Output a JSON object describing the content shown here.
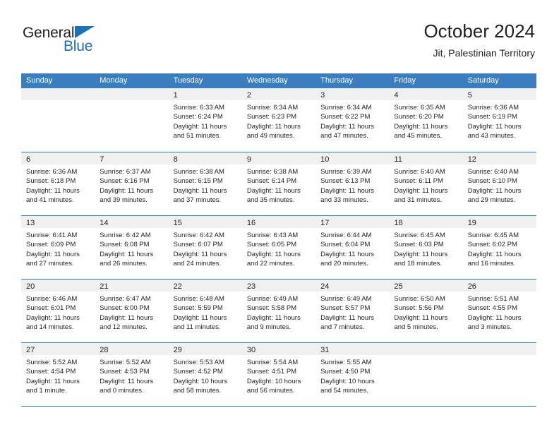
{
  "brand": {
    "name_part1": "General",
    "name_part2": "Blue",
    "triangle_color": "#1b72b8",
    "blue_color": "#1f6fb5"
  },
  "header": {
    "month_title": "October 2024",
    "location": "Jit, Palestinian Territory"
  },
  "theme": {
    "header_blue": "#3a7ebf",
    "daynum_band": "#f0f0f0",
    "text": "#231f20"
  },
  "calendar": {
    "weekday_headers": [
      "Sunday",
      "Monday",
      "Tuesday",
      "Wednesday",
      "Thursday",
      "Friday",
      "Saturday"
    ],
    "weeks": [
      [
        {
          "day": "",
          "lines": []
        },
        {
          "day": "",
          "lines": []
        },
        {
          "day": "1",
          "lines": [
            "Sunrise: 6:33 AM",
            "Sunset: 6:24 PM",
            "Daylight: 11 hours",
            "and 51 minutes."
          ]
        },
        {
          "day": "2",
          "lines": [
            "Sunrise: 6:34 AM",
            "Sunset: 6:23 PM",
            "Daylight: 11 hours",
            "and 49 minutes."
          ]
        },
        {
          "day": "3",
          "lines": [
            "Sunrise: 6:34 AM",
            "Sunset: 6:22 PM",
            "Daylight: 11 hours",
            "and 47 minutes."
          ]
        },
        {
          "day": "4",
          "lines": [
            "Sunrise: 6:35 AM",
            "Sunset: 6:20 PM",
            "Daylight: 11 hours",
            "and 45 minutes."
          ]
        },
        {
          "day": "5",
          "lines": [
            "Sunrise: 6:36 AM",
            "Sunset: 6:19 PM",
            "Daylight: 11 hours",
            "and 43 minutes."
          ]
        }
      ],
      [
        {
          "day": "6",
          "lines": [
            "Sunrise: 6:36 AM",
            "Sunset: 6:18 PM",
            "Daylight: 11 hours",
            "and 41 minutes."
          ]
        },
        {
          "day": "7",
          "lines": [
            "Sunrise: 6:37 AM",
            "Sunset: 6:16 PM",
            "Daylight: 11 hours",
            "and 39 minutes."
          ]
        },
        {
          "day": "8",
          "lines": [
            "Sunrise: 6:38 AM",
            "Sunset: 6:15 PM",
            "Daylight: 11 hours",
            "and 37 minutes."
          ]
        },
        {
          "day": "9",
          "lines": [
            "Sunrise: 6:38 AM",
            "Sunset: 6:14 PM",
            "Daylight: 11 hours",
            "and 35 minutes."
          ]
        },
        {
          "day": "10",
          "lines": [
            "Sunrise: 6:39 AM",
            "Sunset: 6:13 PM",
            "Daylight: 11 hours",
            "and 33 minutes."
          ]
        },
        {
          "day": "11",
          "lines": [
            "Sunrise: 6:40 AM",
            "Sunset: 6:11 PM",
            "Daylight: 11 hours",
            "and 31 minutes."
          ]
        },
        {
          "day": "12",
          "lines": [
            "Sunrise: 6:40 AM",
            "Sunset: 6:10 PM",
            "Daylight: 11 hours",
            "and 29 minutes."
          ]
        }
      ],
      [
        {
          "day": "13",
          "lines": [
            "Sunrise: 6:41 AM",
            "Sunset: 6:09 PM",
            "Daylight: 11 hours",
            "and 27 minutes."
          ]
        },
        {
          "day": "14",
          "lines": [
            "Sunrise: 6:42 AM",
            "Sunset: 6:08 PM",
            "Daylight: 11 hours",
            "and 26 minutes."
          ]
        },
        {
          "day": "15",
          "lines": [
            "Sunrise: 6:42 AM",
            "Sunset: 6:07 PM",
            "Daylight: 11 hours",
            "and 24 minutes."
          ]
        },
        {
          "day": "16",
          "lines": [
            "Sunrise: 6:43 AM",
            "Sunset: 6:05 PM",
            "Daylight: 11 hours",
            "and 22 minutes."
          ]
        },
        {
          "day": "17",
          "lines": [
            "Sunrise: 6:44 AM",
            "Sunset: 6:04 PM",
            "Daylight: 11 hours",
            "and 20 minutes."
          ]
        },
        {
          "day": "18",
          "lines": [
            "Sunrise: 6:45 AM",
            "Sunset: 6:03 PM",
            "Daylight: 11 hours",
            "and 18 minutes."
          ]
        },
        {
          "day": "19",
          "lines": [
            "Sunrise: 6:45 AM",
            "Sunset: 6:02 PM",
            "Daylight: 11 hours",
            "and 16 minutes."
          ]
        }
      ],
      [
        {
          "day": "20",
          "lines": [
            "Sunrise: 6:46 AM",
            "Sunset: 6:01 PM",
            "Daylight: 11 hours",
            "and 14 minutes."
          ]
        },
        {
          "day": "21",
          "lines": [
            "Sunrise: 6:47 AM",
            "Sunset: 6:00 PM",
            "Daylight: 11 hours",
            "and 12 minutes."
          ]
        },
        {
          "day": "22",
          "lines": [
            "Sunrise: 6:48 AM",
            "Sunset: 5:59 PM",
            "Daylight: 11 hours",
            "and 11 minutes."
          ]
        },
        {
          "day": "23",
          "lines": [
            "Sunrise: 6:49 AM",
            "Sunset: 5:58 PM",
            "Daylight: 11 hours",
            "and 9 minutes."
          ]
        },
        {
          "day": "24",
          "lines": [
            "Sunrise: 6:49 AM",
            "Sunset: 5:57 PM",
            "Daylight: 11 hours",
            "and 7 minutes."
          ]
        },
        {
          "day": "25",
          "lines": [
            "Sunrise: 6:50 AM",
            "Sunset: 5:56 PM",
            "Daylight: 11 hours",
            "and 5 minutes."
          ]
        },
        {
          "day": "26",
          "lines": [
            "Sunrise: 5:51 AM",
            "Sunset: 4:55 PM",
            "Daylight: 11 hours",
            "and 3 minutes."
          ]
        }
      ],
      [
        {
          "day": "27",
          "lines": [
            "Sunrise: 5:52 AM",
            "Sunset: 4:54 PM",
            "Daylight: 11 hours",
            "and 1 minute."
          ]
        },
        {
          "day": "28",
          "lines": [
            "Sunrise: 5:52 AM",
            "Sunset: 4:53 PM",
            "Daylight: 11 hours",
            "and 0 minutes."
          ]
        },
        {
          "day": "29",
          "lines": [
            "Sunrise: 5:53 AM",
            "Sunset: 4:52 PM",
            "Daylight: 10 hours",
            "and 58 minutes."
          ]
        },
        {
          "day": "30",
          "lines": [
            "Sunrise: 5:54 AM",
            "Sunset: 4:51 PM",
            "Daylight: 10 hours",
            "and 56 minutes."
          ]
        },
        {
          "day": "31",
          "lines": [
            "Sunrise: 5:55 AM",
            "Sunset: 4:50 PM",
            "Daylight: 10 hours",
            "and 54 minutes."
          ]
        },
        {
          "day": "",
          "lines": []
        },
        {
          "day": "",
          "lines": []
        }
      ]
    ]
  }
}
